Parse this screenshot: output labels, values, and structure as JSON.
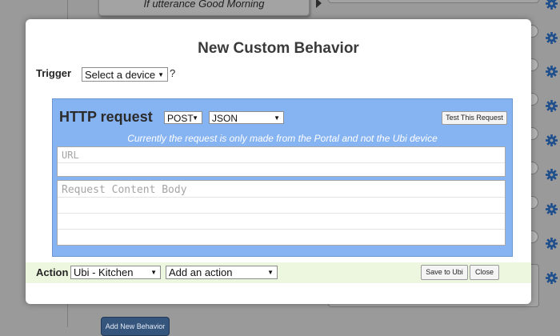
{
  "background": {
    "utterance_text": "If utterance Good Morning",
    "add_behavior_label": "Add New Behavior",
    "gear_icon": "gear-icon",
    "gear_color": "#1f4f8c"
  },
  "modal": {
    "title": "New Custom Behavior",
    "trigger": {
      "label": "Trigger",
      "device_select_value": "Select a device",
      "help": "?"
    },
    "http_request": {
      "title": "HTTP request",
      "method_value": "POST",
      "format_value": "JSON",
      "test_button": "Test This Request",
      "note": "Currently the request is only made from the Portal and not the Ubi device",
      "url_placeholder": "URL",
      "body_placeholder": "Request Content Body",
      "panel_color": "#86b3f1"
    },
    "action": {
      "label": "Action",
      "device_value": "Ubi - Kitchen",
      "action_value": "Add an action",
      "save_button": "Save to Ubi",
      "close_button": "Close",
      "bar_color": "#edf7df"
    }
  }
}
